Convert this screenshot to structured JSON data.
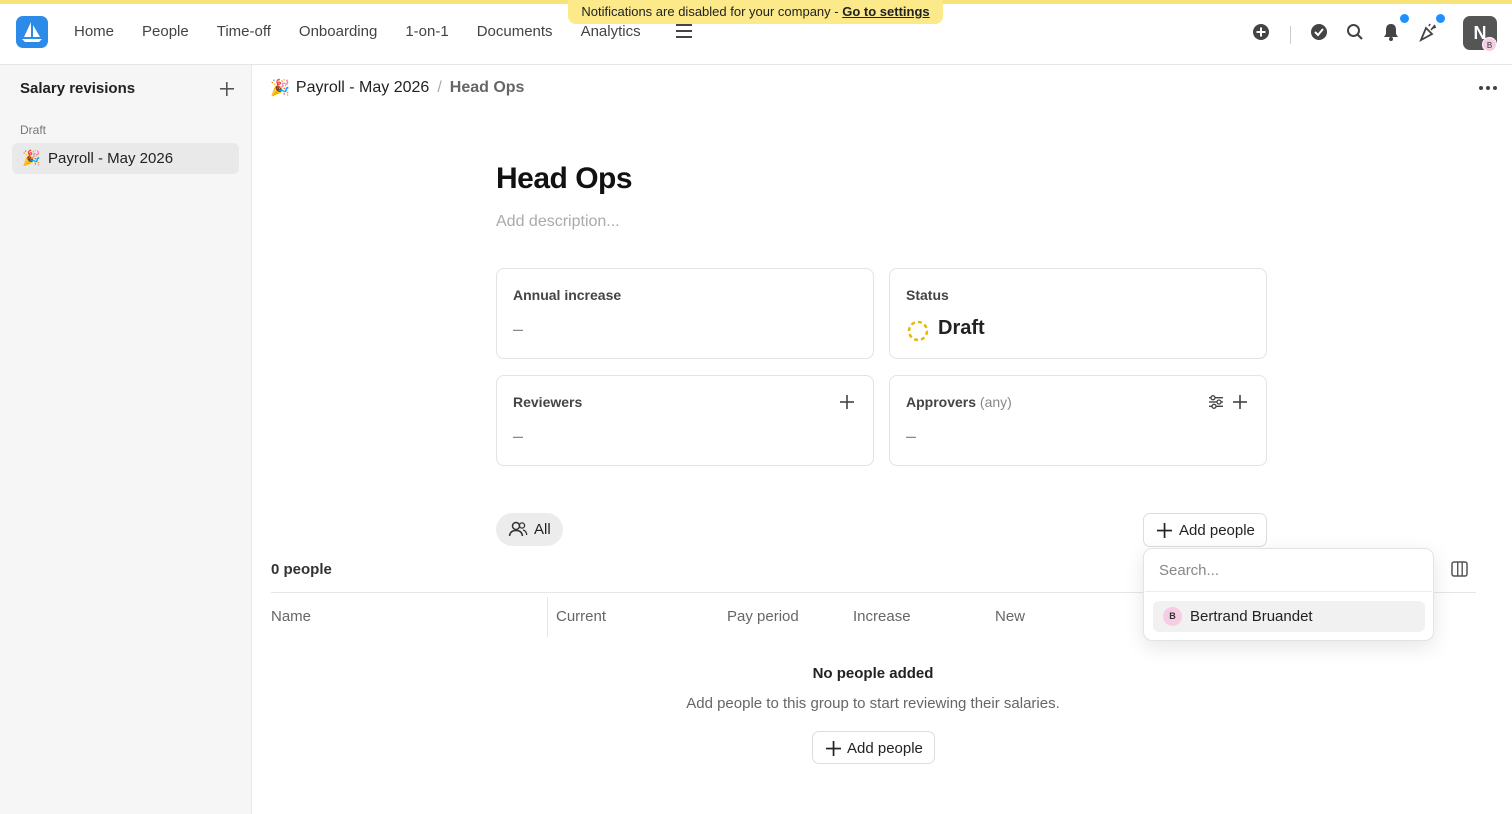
{
  "banner": {
    "text": "Notifications are disabled for your company - ",
    "link": "Go to settings"
  },
  "nav": [
    "Home",
    "People",
    "Time-off",
    "Onboarding",
    "1-on-1",
    "Documents",
    "Analytics"
  ],
  "user": {
    "initial": "N",
    "sub_initial": "B"
  },
  "sidebar": {
    "title": "Salary revisions",
    "section": "Draft",
    "items": [
      {
        "emoji": "🎉",
        "label": "Payroll - May 2026"
      }
    ]
  },
  "breadcrumb": {
    "emoji": "🎉",
    "parent": "Payroll - May 2026",
    "separator": "/",
    "current": "Head Ops"
  },
  "page": {
    "title": "Head Ops",
    "description_placeholder": "Add description..."
  },
  "cards": {
    "annual_increase": {
      "label": "Annual increase",
      "value": "–"
    },
    "status": {
      "label": "Status",
      "value": "Draft"
    },
    "reviewers": {
      "label": "Reviewers",
      "value": "–"
    },
    "approvers": {
      "label": "Approvers",
      "qualifier": "(any)",
      "value": "–"
    }
  },
  "filter": {
    "label": "All"
  },
  "add_people_label": "Add people",
  "table": {
    "count": "0 people",
    "columns": [
      "Name",
      "Current",
      "Pay period",
      "Increase",
      "New"
    ],
    "empty_title": "No people added",
    "empty_subtitle": "Add people to this group to start reviewing their salaries."
  },
  "dropdown": {
    "placeholder": "Search...",
    "options": [
      {
        "initial": "B",
        "name": "Bertrand Bruandet"
      }
    ]
  },
  "colors": {
    "accent": "#2c8ae8",
    "banner": "#fbe98a",
    "status_draft": "#e5b700",
    "notification_dot": "#1e90ff"
  }
}
